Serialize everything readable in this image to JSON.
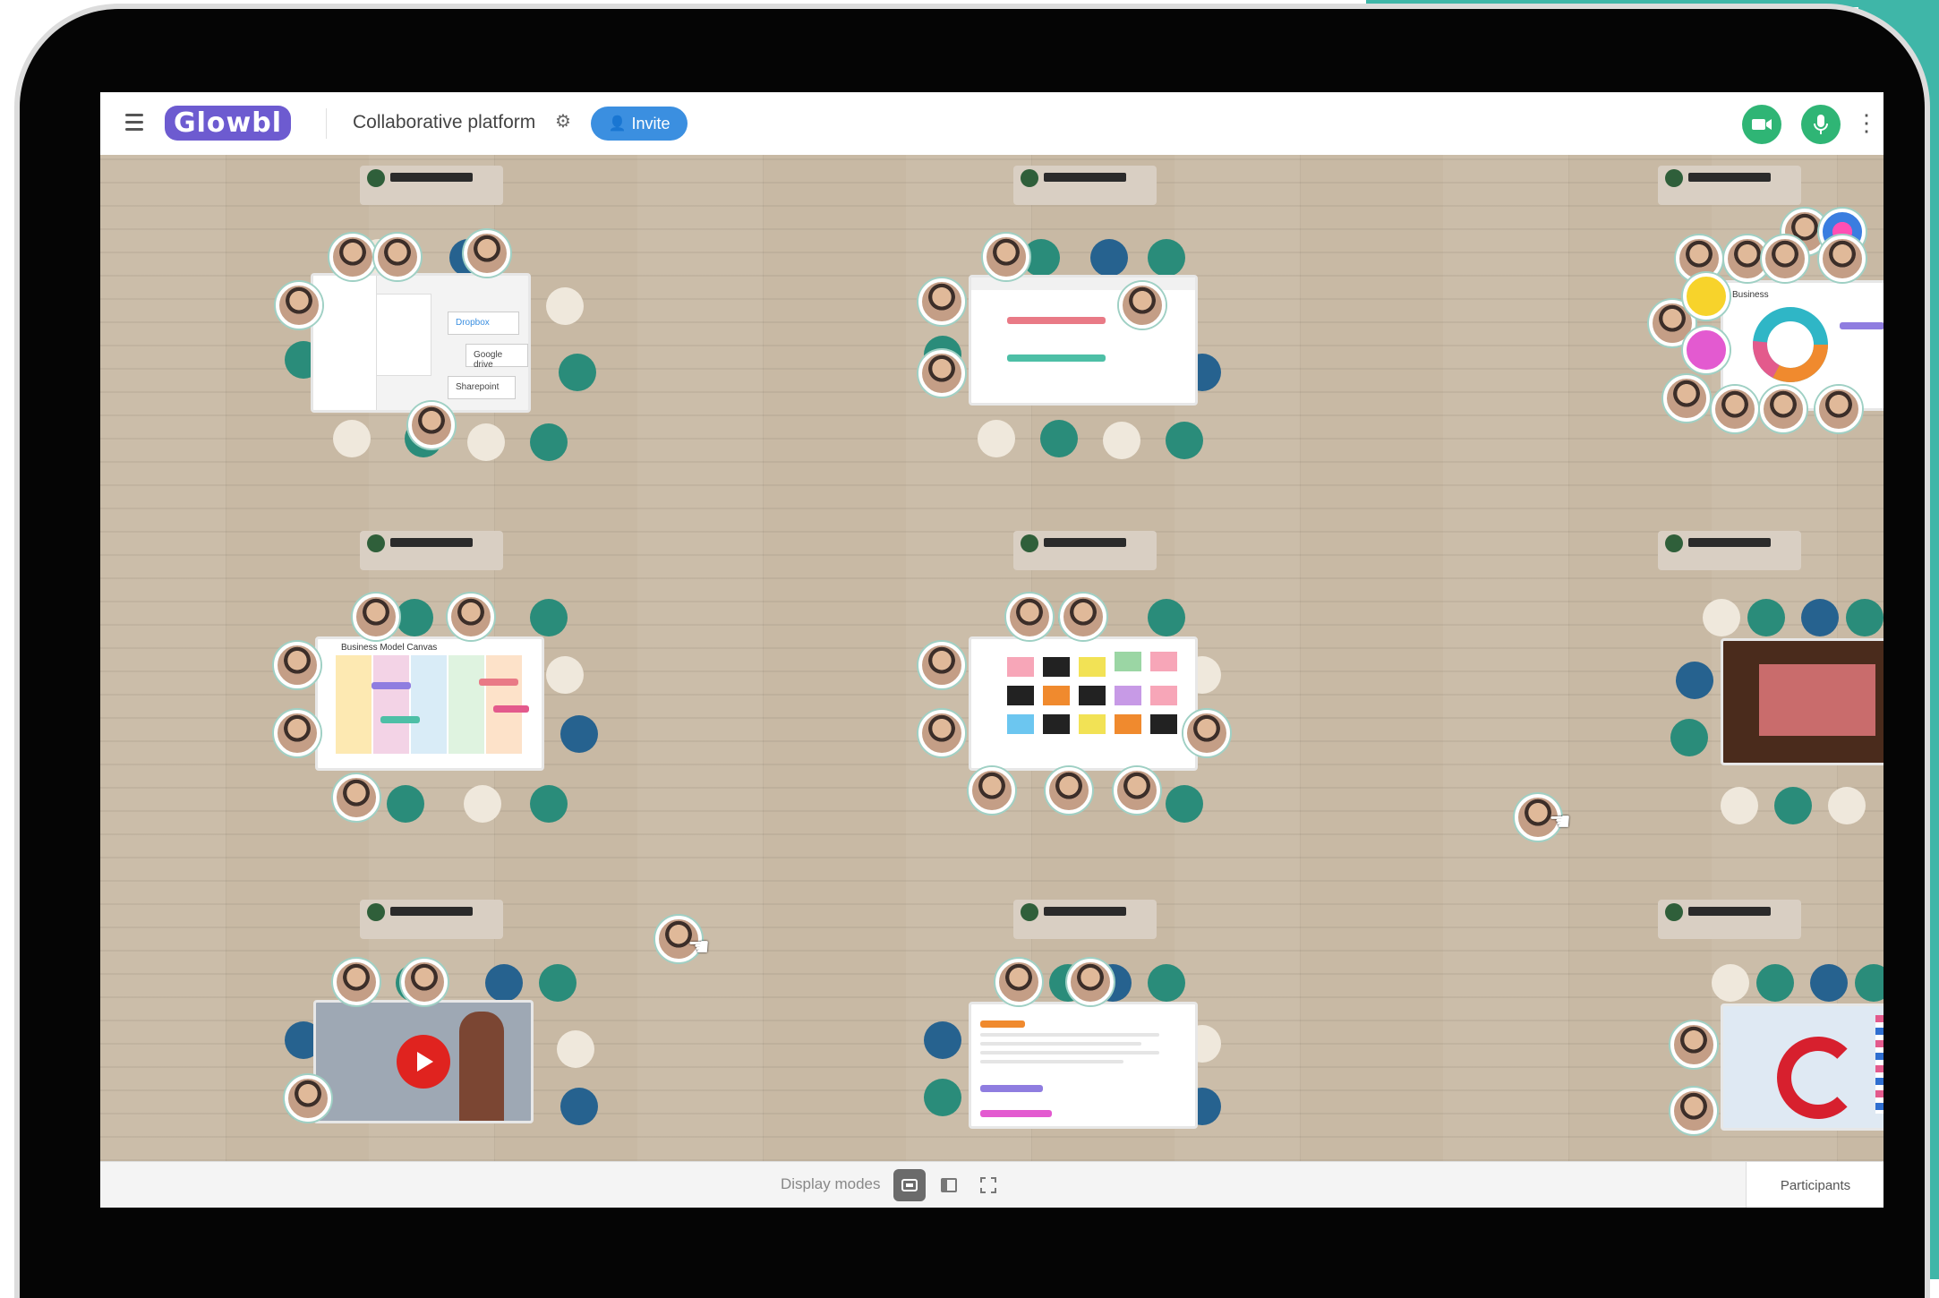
{
  "app": {
    "room_title": "Collaborative platform",
    "invite_label": "Invite",
    "logo_text": "Glowbl"
  },
  "bottom": {
    "display_modes_label": "Display modes",
    "participants_label": "Participants"
  },
  "colors": {
    "accent": "#3b8fe0",
    "camera_button": "#2fb575",
    "mic_button": "#2fb575",
    "brand": "#6d5bd0",
    "frame_teal": "#3fb6a8"
  },
  "icons": {
    "menu": "hamburger-icon",
    "settings": "gear-icon",
    "invite": "add-person-icon",
    "camera": "video-camera-icon",
    "mic": "microphone-icon",
    "more": "kebab-icon",
    "display_mode_1": "grid-view-icon",
    "display_mode_2": "sidebar-view-icon",
    "display_mode_3": "fullscreen-icon"
  },
  "boards": {
    "top_left": {
      "options": [
        "Dropbox",
        "Google drive",
        "Sharepoint"
      ]
    },
    "mid_left": {
      "title": "Business Model Canvas"
    },
    "top_right": {
      "title": "Business"
    }
  }
}
